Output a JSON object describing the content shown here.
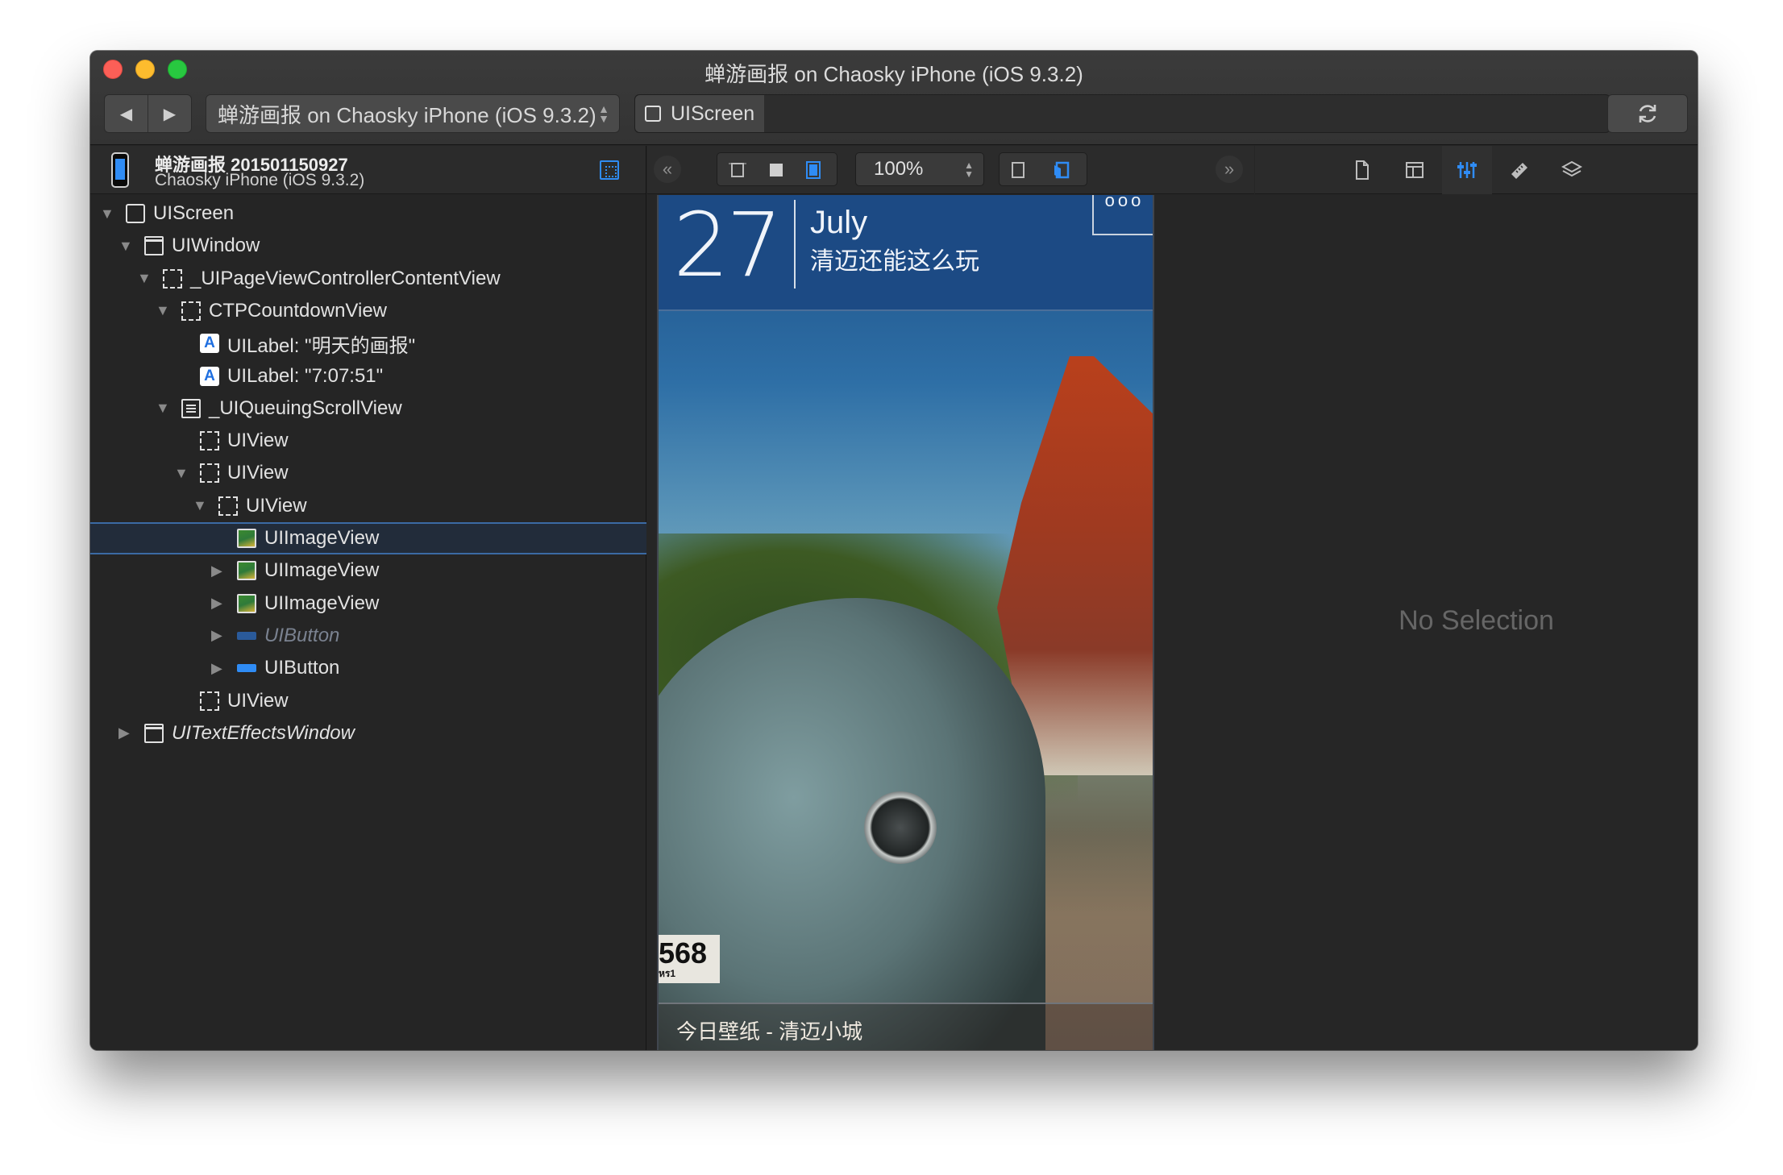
{
  "window": {
    "title": "蝉游画报 on Chaosky iPhone (iOS 9.3.2)"
  },
  "toolbar": {
    "back_icon": "◀",
    "forward_icon": "▶",
    "scheme_label": "蝉游画报 on Chaosky iPhone (iOS 9.3.2)",
    "path_item": "UIScreen",
    "refresh_icon": "refresh-icon"
  },
  "device": {
    "title": "蝉游画报 201501150927",
    "subtitle": "Chaosky iPhone (iOS 9.3.2)"
  },
  "canvas_toolbar": {
    "zoom": "100%",
    "collapse_left": "«",
    "collapse_right": "»"
  },
  "tree": [
    {
      "label": "UIScreen",
      "icon": "screen-icon",
      "disclosure": "▼",
      "indent": 0
    },
    {
      "label": "UIWindow",
      "icon": "window-icon",
      "disclosure": "▼",
      "indent": 1
    },
    {
      "label": "_UIPageViewControllerContentView",
      "icon": "view-icon",
      "disclosure": "▼",
      "indent": 2
    },
    {
      "label": "CTPCountdownView",
      "icon": "view-icon",
      "disclosure": "▼",
      "indent": 3
    },
    {
      "label": "UILabel: \"明天的画报\"",
      "icon": "label-icon",
      "disclosure": "",
      "indent": 4
    },
    {
      "label": "UILabel: \"7:07:51\"",
      "icon": "label-icon",
      "disclosure": "",
      "indent": 4
    },
    {
      "label": "_UIQueuingScrollView",
      "icon": "scrollview-icon",
      "disclosure": "▼",
      "indent": 3
    },
    {
      "label": "UIView",
      "icon": "view-icon",
      "disclosure": "",
      "indent": 4
    },
    {
      "label": "UIView",
      "icon": "view-icon",
      "disclosure": "▼",
      "indent": 4
    },
    {
      "label": "UIView",
      "icon": "view-icon",
      "disclosure": "▼",
      "indent": 5
    },
    {
      "label": "UIImageView",
      "icon": "imageview-icon",
      "disclosure": "",
      "indent": 6,
      "selected": true
    },
    {
      "label": "UIImageView",
      "icon": "imageview-icon",
      "disclosure": "▶",
      "indent": 6
    },
    {
      "label": "UIImageView",
      "icon": "imageview-icon",
      "disclosure": "▶",
      "indent": 6
    },
    {
      "label": "UIButton",
      "icon": "button-icon",
      "disclosure": "▶",
      "indent": 6,
      "hidden": true
    },
    {
      "label": "UIButton",
      "icon": "button-icon",
      "disclosure": "▶",
      "indent": 6
    },
    {
      "label": "UIView",
      "icon": "view-icon",
      "disclosure": "",
      "indent": 4
    },
    {
      "label": "UITextEffectsWindow",
      "icon": "window-icon",
      "disclosure": "▶",
      "indent": 1,
      "italic": true
    }
  ],
  "phone_screen": {
    "day": "27",
    "month": "July",
    "headline": "清迈还能这么玩",
    "more": "ooo",
    "plate_number": "568",
    "plate_small": "หร1",
    "caption": "今日壁纸 - 清迈小城"
  },
  "inspector": {
    "empty_text": "No Selection",
    "tabs": [
      "file-icon",
      "layout-icon",
      "attributes-icon",
      "ruler-icon",
      "layers-icon"
    ],
    "active_tab": 2
  },
  "colors": {
    "accent": "#2f8cf5",
    "selection_border": "#3b6aa4",
    "window_bg": "#262626"
  }
}
